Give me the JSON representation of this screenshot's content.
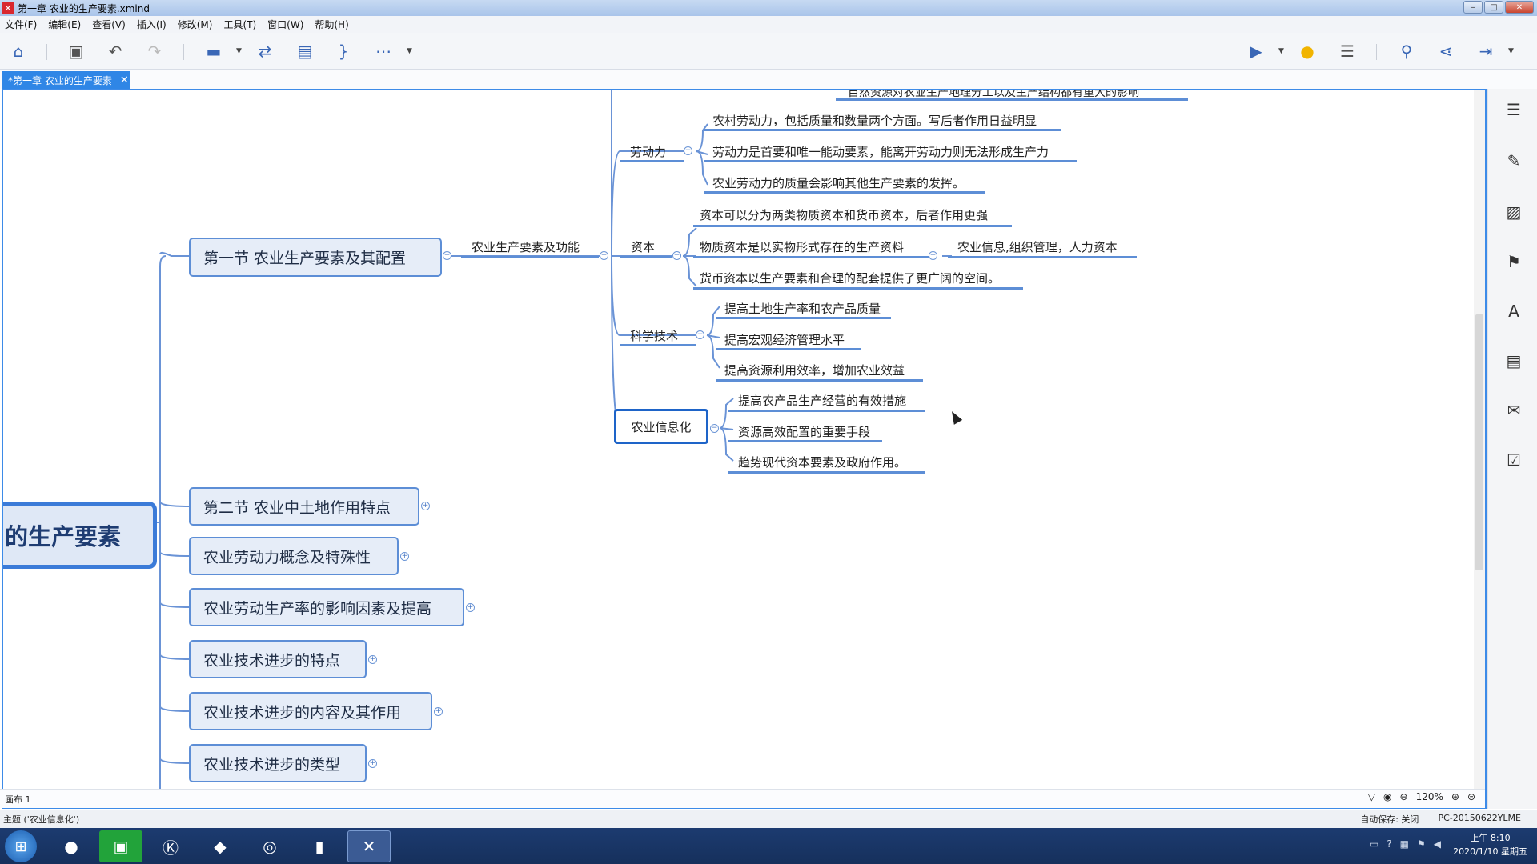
{
  "window": {
    "title": "第一章 农业的生产要素.xmind"
  },
  "menu": [
    "文件(F)",
    "编辑(E)",
    "查看(V)",
    "插入(I)",
    "修改(M)",
    "工具(T)",
    "窗口(W)",
    "帮助(H)"
  ],
  "tab": {
    "label": "*第一章 农业的生产要素"
  },
  "map": {
    "central": "的生产要素",
    "cut_top": "自然资源对农业生产地理分工以及生产结构都有重大的影响",
    "section1": "第一节  农业生产要素及其配置",
    "function_node": "农业生产要素及功能",
    "labor": {
      "label": "劳动力",
      "items": [
        "农村劳动力，包括质量和数量两个方面。写后者作用日益明显",
        "劳动力是首要和唯一能动要素，能离开劳动力则无法形成生产力",
        "农业劳动力的质量会影响其他生产要素的发挥。"
      ]
    },
    "capital": {
      "label": "资本",
      "items": [
        "资本可以分为两类物质资本和货币资本，后者作用更强",
        "物质资本是以实物形式存在的生产资料",
        "货币资本以生产要素和合理的配套提供了更广阔的空间。"
      ],
      "sub": "农业信息,组织管理，人力资本"
    },
    "tech": {
      "label": "科学技术",
      "items": [
        "提高土地生产率和农产品质量",
        "提高宏观经济管理水平",
        "提高资源利用效率，增加农业效益"
      ]
    },
    "info": {
      "label": "农业信息化",
      "items": [
        "提高农产品生产经营的有效措施",
        "资源高效配置的重要手段",
        "趋势现代资本要素及政府作用。"
      ]
    },
    "sections": [
      "第二节 农业中土地作用特点",
      "农业劳动力概念及特殊性",
      "农业劳动生产率的影响因素及提高",
      "农业技术进步的特点",
      "农业技术进步的内容及其作用",
      "农业技术进步的类型"
    ]
  },
  "sheet": {
    "name": "画布 1",
    "zoom": "120%"
  },
  "status": {
    "topic": "主题 ('农业信息化')",
    "autosave": "自动保存: 关闭",
    "computer": "PC-20150622YLME"
  },
  "taskbar": {
    "time": "上午 8:10",
    "date": "2020/1/10 星期五"
  }
}
